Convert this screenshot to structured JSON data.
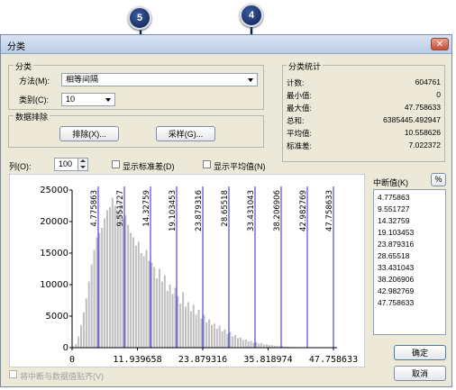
{
  "callouts": [
    "5",
    "4"
  ],
  "window": {
    "title": "分类",
    "close": "✕"
  },
  "classification": {
    "group_label": "分类",
    "method_label": "方法(M):",
    "method_value": "相等间隔",
    "classes_label": "类别(C):",
    "classes_value": "10"
  },
  "exclusion": {
    "group_label": "数据排除",
    "exclude_button": "排除(X)...",
    "sample_button": "采样(G)..."
  },
  "stats": {
    "group_label": "分类统计",
    "rows": [
      {
        "label": "计数:",
        "value": "604761"
      },
      {
        "label": "最小值:",
        "value": "0"
      },
      {
        "label": "最大值:",
        "value": "47.758633"
      },
      {
        "label": "总和:",
        "value": "6385445.492947"
      },
      {
        "label": "平均值:",
        "value": "10.558626"
      },
      {
        "label": "标准差:",
        "value": "7.022372"
      }
    ]
  },
  "toolbar": {
    "columns_label": "列(O):",
    "columns_value": "100",
    "show_std_label": "显示标准差(D)",
    "show_mean_label": "显示平均值(N)"
  },
  "chart_data": {
    "type": "bar",
    "ylim": [
      0,
      25000
    ],
    "xlim": [
      0,
      47.758633
    ],
    "y_ticks": [
      "25000",
      "20000",
      "15000",
      "10000",
      "5000",
      "0"
    ],
    "x_ticks": [
      "0",
      "11.939658",
      "23.879316",
      "35.818974",
      "47.758633"
    ],
    "breaks": [
      4.775863,
      9.551727,
      14.32759,
      19.103453,
      23.879316,
      28.65518,
      33.431043,
      38.206906,
      42.982769,
      47.758633
    ],
    "break_labels": [
      "4.775863",
      "9.551727",
      "14.32759",
      "19.103453",
      "23.879316",
      "28.65518",
      "33.431043",
      "38.206906",
      "42.982769",
      "47.758633"
    ],
    "bin_count": 100,
    "values": [
      200,
      600,
      1800,
      3600,
      5600,
      7800,
      10500,
      13200,
      15500,
      17500,
      18200,
      19000,
      20500,
      21800,
      22300,
      23800,
      22500,
      21500,
      23200,
      20500,
      21000,
      19500,
      18200,
      17500,
      16200,
      16800,
      15000,
      14500,
      15500,
      13800,
      13500,
      12800,
      11000,
      12500,
      10500,
      11500,
      9000,
      10000,
      8500,
      9500,
      8200,
      7000,
      8800,
      6500,
      7200,
      5800,
      6800,
      5200,
      6000,
      4600,
      5200,
      4000,
      4500,
      3600,
      3800,
      3000,
      3500,
      2600,
      2900,
      2200,
      2500,
      1800,
      2000,
      1500,
      1600,
      1200,
      1300,
      1000,
      1100,
      800,
      900,
      650,
      700,
      500,
      550,
      400,
      420,
      300,
      320,
      220,
      240,
      160,
      170,
      120,
      120,
      80,
      85,
      60,
      60,
      40,
      40,
      30,
      30,
      20,
      20,
      12,
      12,
      8,
      6,
      4
    ]
  },
  "breaks_panel": {
    "label": "中断值(K)",
    "percent_button": "%",
    "items": [
      "4.775863",
      "9.551727",
      "14.32759",
      "19.103453",
      "23.879316",
      "28.65518",
      "33.431043",
      "38.206906",
      "42.982769",
      "47.758633"
    ]
  },
  "footer": {
    "snap_label": "将中断与数据值贴齐(V)",
    "ok_button": "确定",
    "cancel_button": "取消"
  }
}
